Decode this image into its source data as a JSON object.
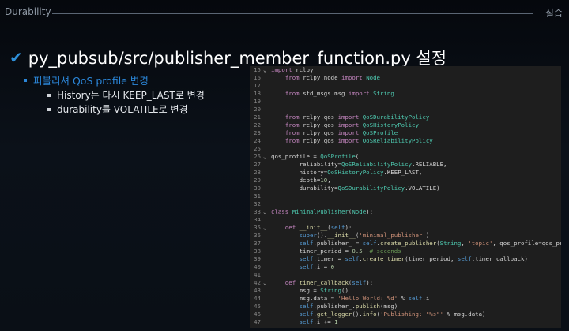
{
  "header": {
    "section_label": "Durability",
    "page_label": "실습"
  },
  "heading": {
    "check_icon": "check-mark-icon",
    "title": "py_pubsub/src/publisher_member_function.py 설정"
  },
  "bullets": {
    "l1": "퍼블리셔 QoS profile 변경",
    "l2": [
      "History는 다시 KEEP_LAST로 변경",
      "durability를 VOLATILE로 변경"
    ]
  },
  "code": {
    "lines": [
      {
        "n": "15",
        "fold": "v",
        "t": "import rclpy"
      },
      {
        "n": "16",
        "fold": "",
        "t": "    from rclpy.node import Node"
      },
      {
        "n": "17",
        "fold": "",
        "t": ""
      },
      {
        "n": "18",
        "fold": "",
        "t": "    from std_msgs.msg import String"
      },
      {
        "n": "19",
        "fold": "",
        "t": ""
      },
      {
        "n": "20",
        "fold": "",
        "t": ""
      },
      {
        "n": "21",
        "fold": "",
        "t": "    from rclpy.qos import QoSDurabilityPolicy"
      },
      {
        "n": "22",
        "fold": "",
        "t": "    from rclpy.qos import QoSHistoryPolicy"
      },
      {
        "n": "23",
        "fold": "",
        "t": "    from rclpy.qos import QoSProfile"
      },
      {
        "n": "24",
        "fold": "",
        "t": "    from rclpy.qos import QoSReliabilityPolicy"
      },
      {
        "n": "25",
        "fold": "",
        "t": ""
      },
      {
        "n": "26",
        "fold": "v",
        "t": "qos_profile = QoSProfile("
      },
      {
        "n": "27",
        "fold": "",
        "t": "        reliability=QoSReliabilityPolicy.RELIABLE,"
      },
      {
        "n": "28",
        "fold": "",
        "t": "        history=QoSHistoryPolicy.KEEP_LAST,"
      },
      {
        "n": "29",
        "fold": "",
        "t": "        depth=10,"
      },
      {
        "n": "30",
        "fold": "",
        "t": "        durability=QoSDurabilityPolicy.VOLATILE)"
      },
      {
        "n": "31",
        "fold": "",
        "t": ""
      },
      {
        "n": "32",
        "fold": "",
        "t": ""
      },
      {
        "n": "33",
        "fold": "v",
        "t": "class MinimalPublisher(Node):"
      },
      {
        "n": "34",
        "fold": "",
        "t": ""
      },
      {
        "n": "35",
        "fold": "v",
        "t": "    def __init__(self):"
      },
      {
        "n": "36",
        "fold": "",
        "t": "        super().__init__('minimal_publisher')"
      },
      {
        "n": "37",
        "fold": "",
        "t": "        self.publisher_ = self.create_publisher(String, 'topic', qos_profile=qos_profile)"
      },
      {
        "n": "38",
        "fold": "",
        "t": "        timer_period = 0.5  # seconds"
      },
      {
        "n": "39",
        "fold": "",
        "t": "        self.timer = self.create_timer(timer_period, self.timer_callback)"
      },
      {
        "n": "40",
        "fold": "",
        "t": "        self.i = 0"
      },
      {
        "n": "41",
        "fold": "",
        "t": ""
      },
      {
        "n": "42",
        "fold": "v",
        "t": "    def timer_callback(self):"
      },
      {
        "n": "43",
        "fold": "",
        "t": "        msg = String()"
      },
      {
        "n": "44",
        "fold": "",
        "t": "        msg.data = 'Hello World: %d' % self.i"
      },
      {
        "n": "45",
        "fold": "",
        "t": "        self.publisher_.publish(msg)"
      },
      {
        "n": "46",
        "fold": "",
        "t": "        self.get_logger().info('Publishing: \"%s\"' % msg.data)"
      },
      {
        "n": "47",
        "fold": "",
        "t": "        self.i += 1"
      }
    ]
  },
  "colors": {
    "accent_blue": "#2b86d9",
    "editor_bg": "#1e1e1e",
    "keyword": "#c586c0",
    "builtin": "#569cd6",
    "function": "#dcdcaa",
    "class": "#4ec9b0",
    "string": "#ce9178",
    "number": "#b5cea8",
    "comment": "#6a9955"
  }
}
